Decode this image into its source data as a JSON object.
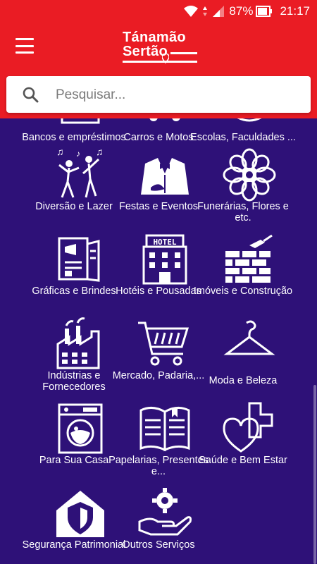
{
  "status_bar": {
    "battery": "87%",
    "time": "21:17"
  },
  "app": {
    "logo_line1": "Tánamão",
    "logo_line2": "Sertão",
    "brand_color": "#ea1c24",
    "background_color": "#2e1178"
  },
  "search": {
    "placeholder": "Pesquisar..."
  },
  "categories": [
    {
      "label": "Bancos e empréstimos",
      "icon": "bank-icon"
    },
    {
      "label": "Carros e Motos",
      "icon": "car-icon"
    },
    {
      "label": "Escolas, Faculdades ...",
      "icon": "school-icon"
    },
    {
      "label": "Diversão e Lazer",
      "icon": "dancing-people-icon"
    },
    {
      "label": "Festas e Eventos",
      "icon": "tuxedo-icon"
    },
    {
      "label": "Funerárias, Flores e etc.",
      "icon": "flower-icon"
    },
    {
      "label": "Gráficas e Brindes",
      "icon": "printed-flyer-icon"
    },
    {
      "label": "Hotéis e Pousadas",
      "icon": "hotel-icon"
    },
    {
      "label": "Imóveis e Construção",
      "icon": "brick-wall-icon"
    },
    {
      "label": "Indústrias e Fornecedores",
      "icon": "factory-icon"
    },
    {
      "label": "Mercado, Padaria,...",
      "icon": "shopping-cart-icon"
    },
    {
      "label": "Moda e Beleza",
      "icon": "hanger-icon"
    },
    {
      "label": "Para Sua Casa",
      "icon": "washing-machine-icon"
    },
    {
      "label": "Papelarias, Presentes e...",
      "icon": "open-book-icon"
    },
    {
      "label": "Saúde e Bem Estar",
      "icon": "health-heart-icon"
    },
    {
      "label": "Segurança Patrimonial",
      "icon": "home-shield-icon"
    },
    {
      "label": "Outros Serviços",
      "icon": "gear-hand-icon"
    }
  ]
}
